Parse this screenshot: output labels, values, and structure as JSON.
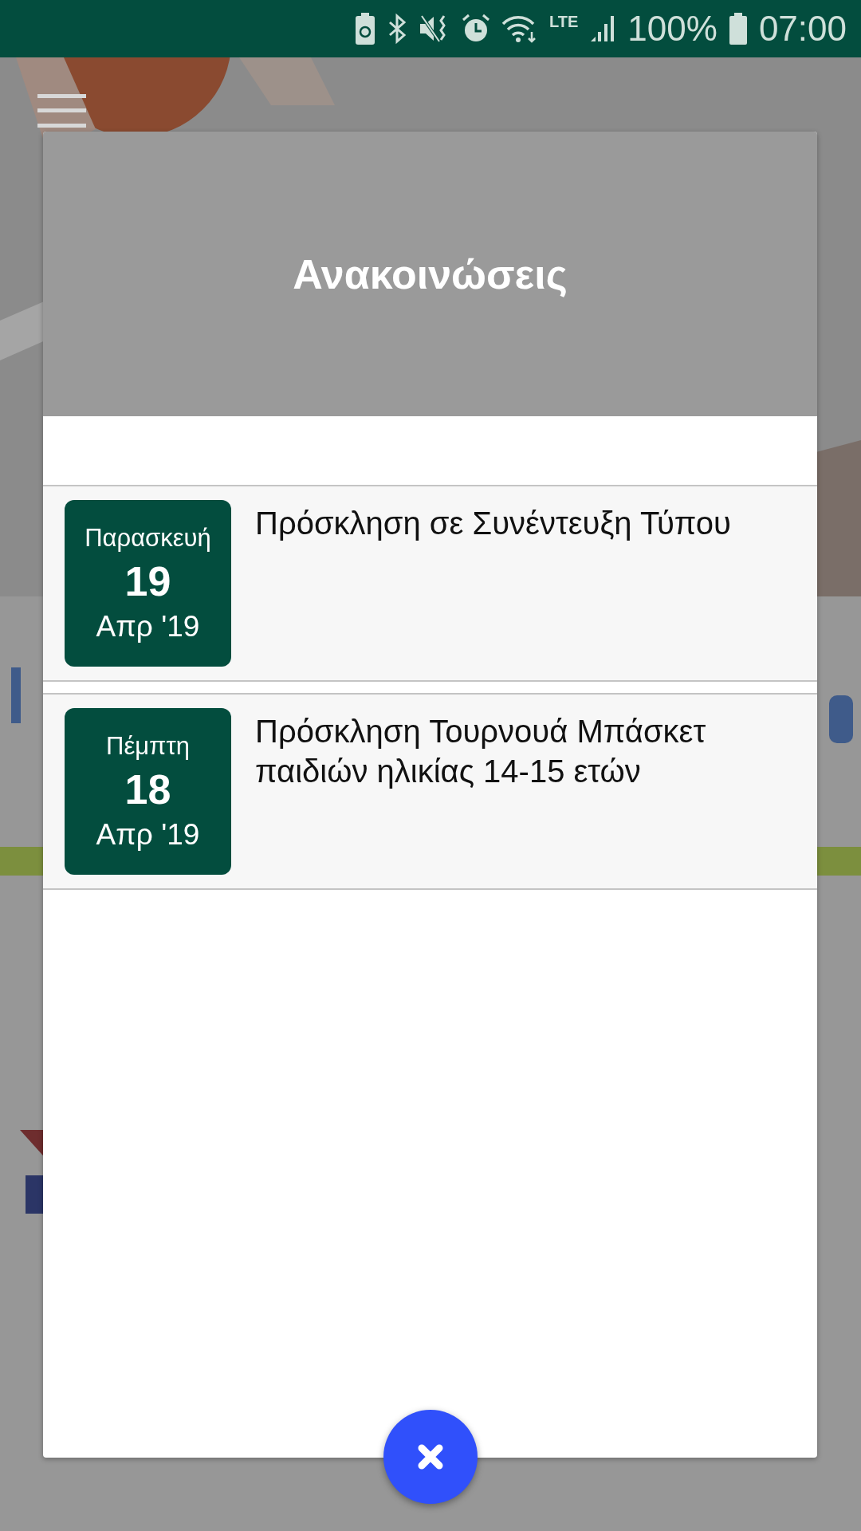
{
  "status_bar": {
    "battery": "100%",
    "time": "07:00",
    "network": "LTE"
  },
  "dialog": {
    "title": "Ανακοινώσεις",
    "announcements": [
      {
        "weekday": "Παρασκευή",
        "day": "19",
        "month": "Απρ '19",
        "title": "Πρόσκληση σε Συνέντευξη Τύπου"
      },
      {
        "weekday": "Πέμπτη",
        "day": "18",
        "month": "Απρ '19",
        "title": "Πρόσκληση Τουρνουά Μπάσκετ παιδιών ηλικίας 14-15 ετών"
      }
    ]
  }
}
